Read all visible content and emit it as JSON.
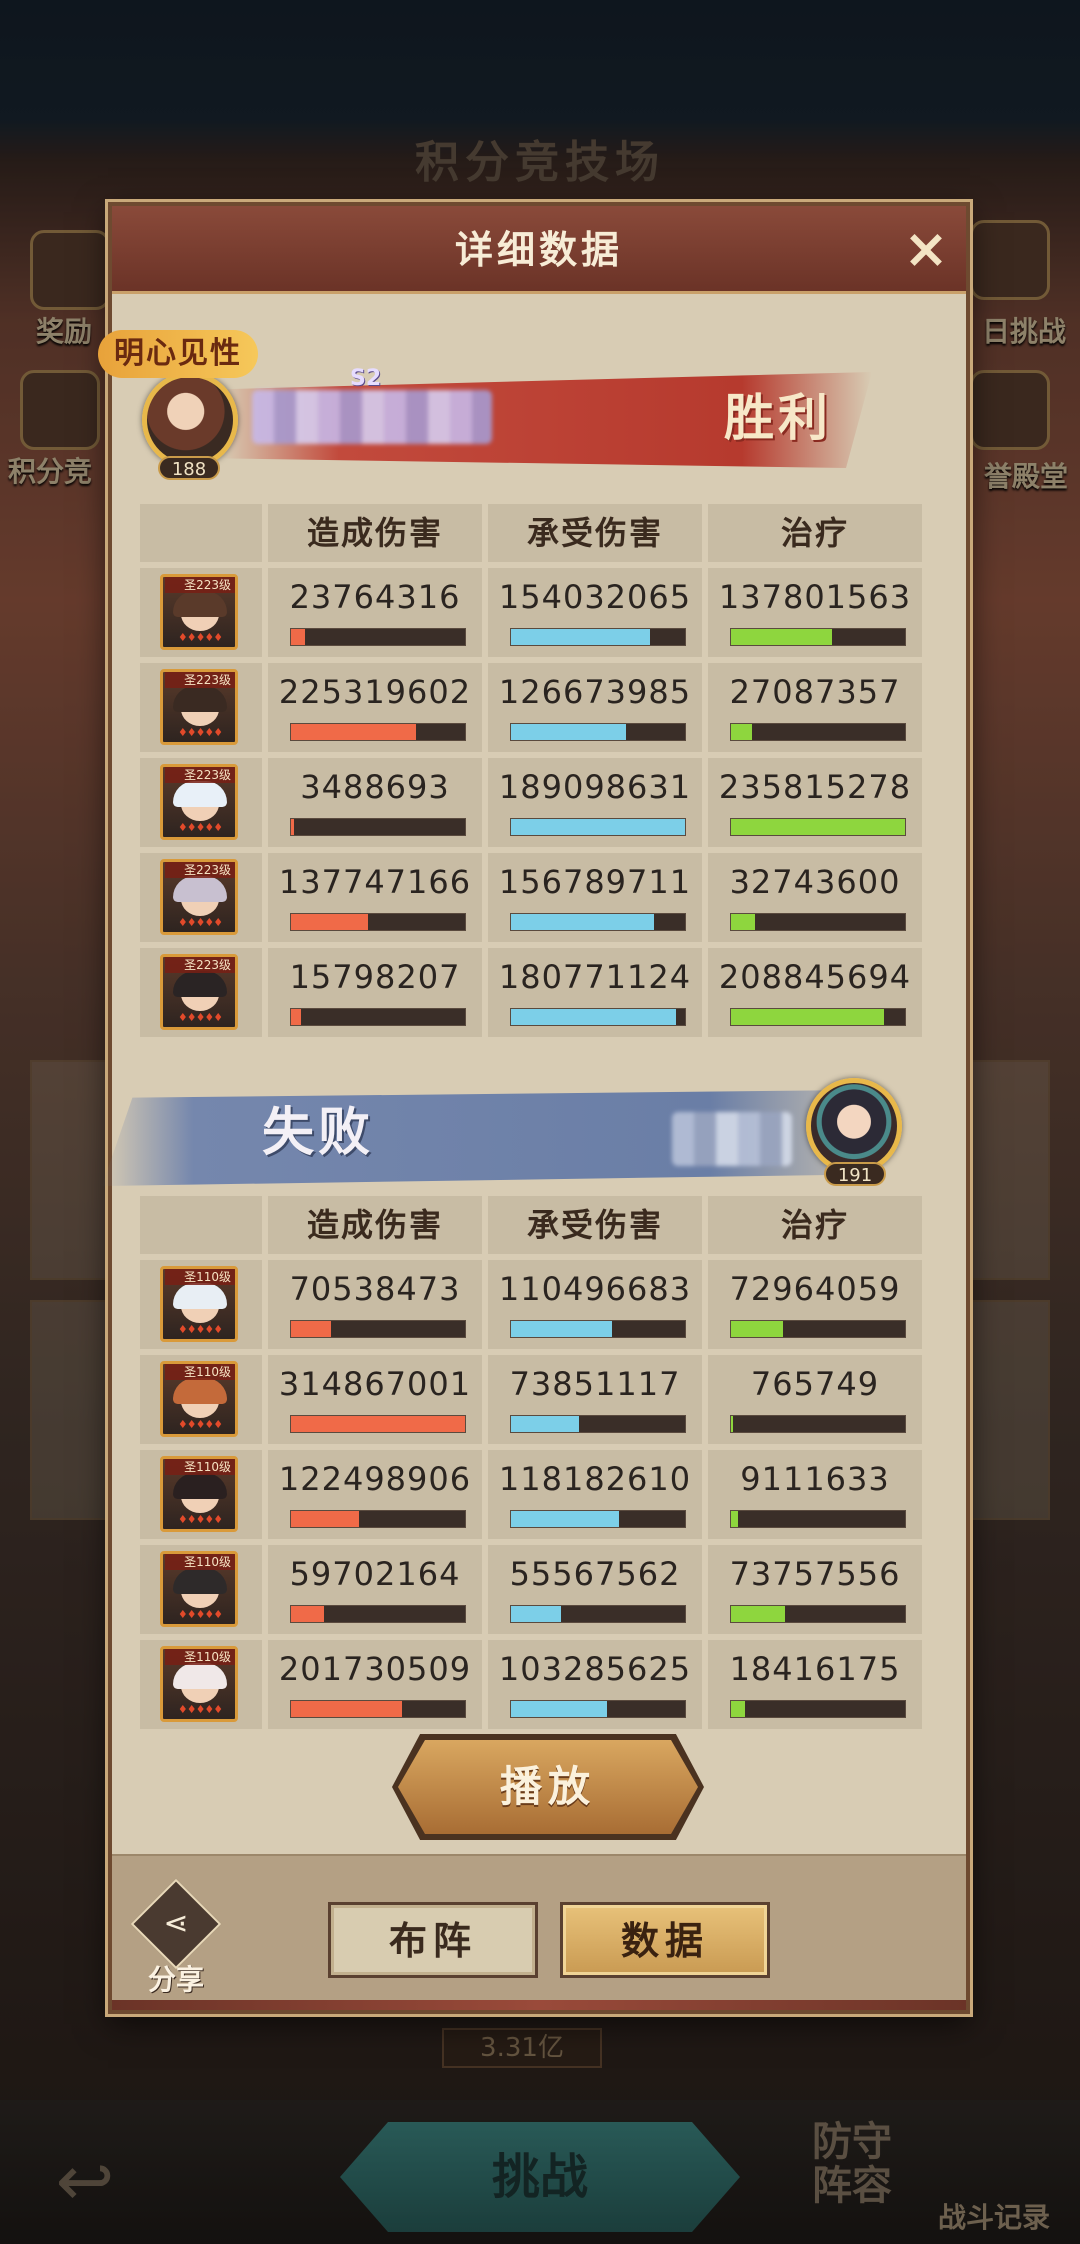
{
  "background": {
    "title": "积分竞技场",
    "left_labels": [
      "奖励",
      "积分竞"
    ],
    "right_labels": [
      "日挑战",
      "誉殿堂"
    ],
    "power": "3.31亿",
    "challenge_label": "挑战",
    "defense_label": "防守阵容",
    "record_label": "战斗记录"
  },
  "modal": {
    "title": "详细数据",
    "close_icon": "×"
  },
  "winner": {
    "title_tag": "明心见性",
    "season": "S2",
    "result": "胜利",
    "level": "188"
  },
  "loser": {
    "result": "失败",
    "level": "191"
  },
  "columns": {
    "c1": "造成伤害",
    "c2": "承受伤害",
    "c3": "治疗"
  },
  "win_rows": [
    {
      "hero_level": "圣223级",
      "damage": "23764316",
      "taken": "154032065",
      "heal": "137801563",
      "damage_pct": 0.08,
      "taken_pct": 0.8,
      "heal_pct": 0.58
    },
    {
      "hero_level": "圣223级",
      "damage": "225319602",
      "taken": "126673985",
      "heal": "27087357",
      "damage_pct": 0.72,
      "taken_pct": 0.66,
      "heal_pct": 0.12
    },
    {
      "hero_level": "圣223级",
      "damage": "3488693",
      "taken": "189098631",
      "heal": "235815278",
      "damage_pct": 0.02,
      "taken_pct": 1.0,
      "heal_pct": 1.0
    },
    {
      "hero_level": "圣223级",
      "damage": "137747166",
      "taken": "156789711",
      "heal": "32743600",
      "damage_pct": 0.44,
      "taken_pct": 0.82,
      "heal_pct": 0.14
    },
    {
      "hero_level": "圣223级",
      "damage": "15798207",
      "taken": "180771124",
      "heal": "208845694",
      "damage_pct": 0.06,
      "taken_pct": 0.95,
      "heal_pct": 0.88
    }
  ],
  "lose_rows": [
    {
      "hero_level": "圣110级",
      "damage": "70538473",
      "taken": "110496683",
      "heal": "72964059",
      "damage_pct": 0.23,
      "taken_pct": 0.58,
      "heal_pct": 0.3
    },
    {
      "hero_level": "圣110级",
      "damage": "314867001",
      "taken": "73851117",
      "heal": "765749",
      "damage_pct": 1.0,
      "taken_pct": 0.39,
      "heal_pct": 0.01
    },
    {
      "hero_level": "圣110级",
      "damage": "122498906",
      "taken": "118182610",
      "heal": "9111633",
      "damage_pct": 0.39,
      "taken_pct": 0.62,
      "heal_pct": 0.04
    },
    {
      "hero_level": "圣110级",
      "damage": "59702164",
      "taken": "55567562",
      "heal": "73757556",
      "damage_pct": 0.19,
      "taken_pct": 0.29,
      "heal_pct": 0.31
    },
    {
      "hero_level": "圣110级",
      "damage": "201730509",
      "taken": "103285625",
      "heal": "18416175",
      "damage_pct": 0.64,
      "taken_pct": 0.55,
      "heal_pct": 0.08
    }
  ],
  "buttons": {
    "play": "播放",
    "share": "分享",
    "formation": "布阵",
    "data": "数据"
  },
  "colors": {
    "damage_bar": "#f06a48",
    "taken_bar": "#7ccfe8",
    "heal_bar": "#8ed63e",
    "hero_hair_win": [
      "#5a3a2a",
      "#3a2a22",
      "#e8f0f8",
      "#c8c0d0",
      "#2a2424"
    ],
    "hero_hair_lose": [
      "#e8eef4",
      "#c46a3a",
      "#2a2020",
      "#2e2a2a",
      "#f0e8e8"
    ]
  }
}
